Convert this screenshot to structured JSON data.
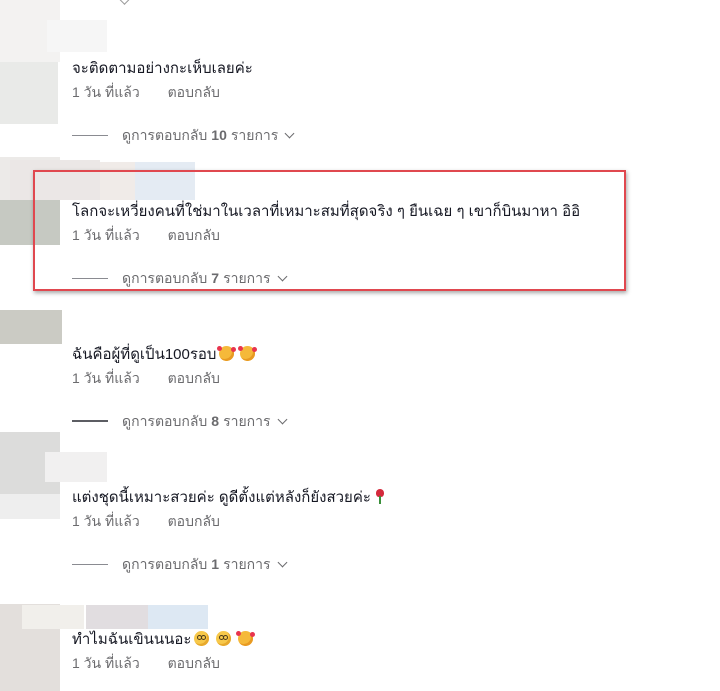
{
  "comments": [
    {
      "text": "จะติดตามอย่างกะเห็บเลยค่ะ",
      "time": "1 วัน ที่แล้ว",
      "reply": "ตอบกลับ",
      "view_prefix": "ดูการตอบกลับ",
      "view_count": "10",
      "view_suffix": "รายการ"
    },
    {
      "text": "โลกจะเหวี่ยงคนที่ใช่มาในเวลาที่เหมาะสมที่สุดจริง ๆ ยืนเฉย ๆ เขาก็บินมาหา อิอิ",
      "time": "1 วัน ที่แล้ว",
      "reply": "ตอบกลับ",
      "view_prefix": "ดูการตอบกลับ",
      "view_count": "7",
      "view_suffix": "รายการ"
    },
    {
      "text": "ฉันคือผู้ที่ดูเป็น100รอบ",
      "emojis": [
        "smiling-face-with-hearts",
        "smiling-face-with-hearts"
      ],
      "time": "1 วัน ที่แล้ว",
      "reply": "ตอบกลับ",
      "view_prefix": "ดูการตอบกลับ",
      "view_count": "8",
      "view_suffix": "รายการ"
    },
    {
      "text": "แต่งชุดนี้เหมาะสวยค่ะ ดูดีตั้งแต่หลังก็ยังสวยค่ะ",
      "emojis": [
        "rose"
      ],
      "time": "1 วัน ที่แล้ว",
      "reply": "ตอบกลับ",
      "view_prefix": "ดูการตอบกลับ",
      "view_count": "1",
      "view_suffix": "รายการ"
    },
    {
      "text": "ทำไมฉันเขินนนอะ",
      "emojis": [
        "flushed-face",
        "flushed-face",
        "smiling-face-with-hearts"
      ],
      "time": "1 วัน ที่แล้ว",
      "reply": "ตอบกลับ"
    }
  ],
  "colors": {
    "text": "#161823",
    "secondary": "#6b6b6e",
    "highlight_border": "#e0484f"
  }
}
